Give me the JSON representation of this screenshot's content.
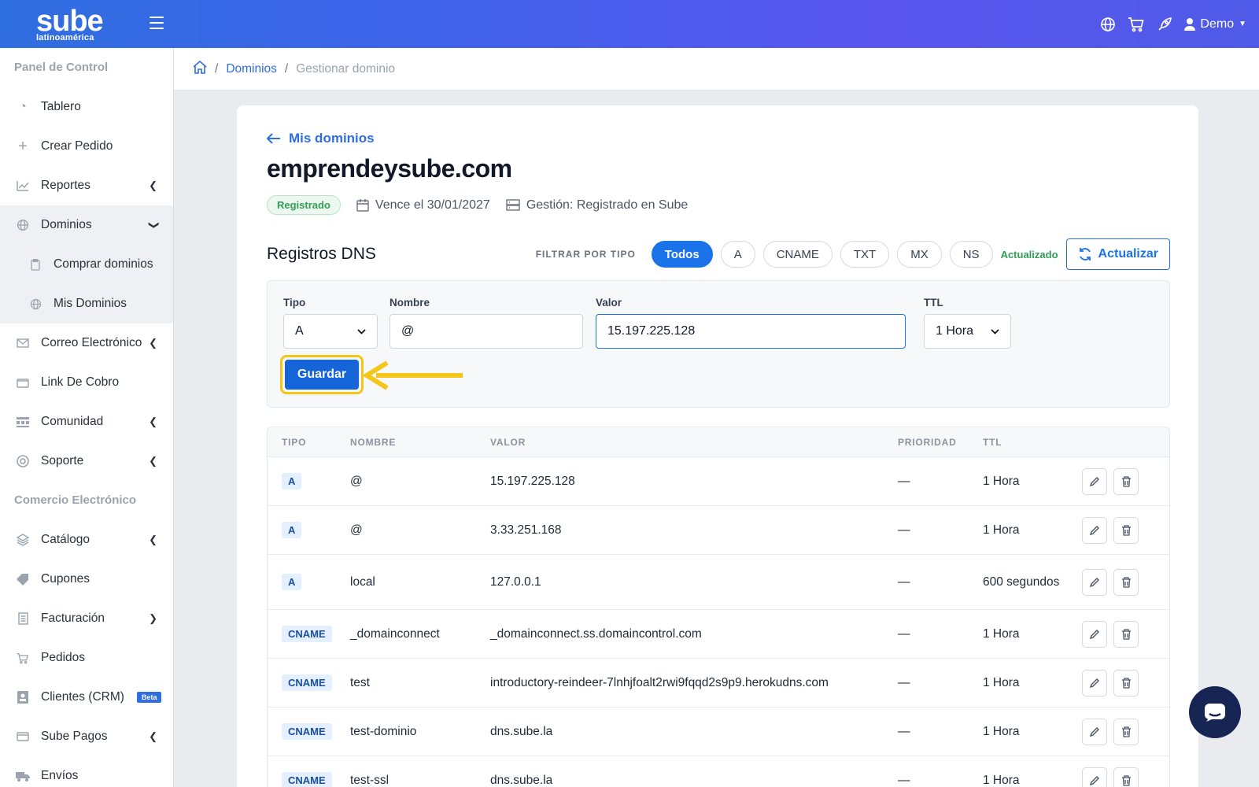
{
  "app": {
    "logo_main": "sube",
    "logo_sub": "latinoamérica",
    "user": "Demo"
  },
  "sidebar": {
    "section1": "Panel de Control",
    "section2": "Comercio Electrónico",
    "items": [
      {
        "label": "Tablero",
        "icon": "gauge-icon"
      },
      {
        "label": "Crear Pedido",
        "icon": "plus-icon"
      },
      {
        "label": "Reportes",
        "icon": "chart-line-icon"
      },
      {
        "label": "Dominios",
        "icon": "globe-icon"
      },
      {
        "label": "Comprar dominios",
        "icon": "clipboard-icon"
      },
      {
        "label": "Mis Dominios",
        "icon": "globe-icon"
      },
      {
        "label": "Correo Electrónico",
        "icon": "envelope-icon"
      },
      {
        "label": "Link De Cobro",
        "icon": "wallet-icon"
      },
      {
        "label": "Comunidad",
        "icon": "community-icon"
      },
      {
        "label": "Soporte",
        "icon": "lifebuoy-icon"
      },
      {
        "label": "Catálogo",
        "icon": "layers-icon"
      },
      {
        "label": "Cupones",
        "icon": "tag-icon"
      },
      {
        "label": "Facturación",
        "icon": "receipt-icon"
      },
      {
        "label": "Pedidos",
        "icon": "cart-icon"
      },
      {
        "label": "Clientes (CRM)",
        "icon": "contacts-icon",
        "badge": "Beta"
      },
      {
        "label": "Sube Pagos",
        "icon": "card-icon"
      },
      {
        "label": "Envíos",
        "icon": "truck-icon"
      }
    ]
  },
  "breadcrumb": {
    "link": "Dominios",
    "current": "Gestionar dominio"
  },
  "header": {
    "back": "Mis dominios",
    "domain": "emprendeysube.com",
    "status": "Registrado",
    "expires": "Vence el 30/01/2027",
    "management": "Gestión: Registrado en Sube"
  },
  "dns": {
    "title": "Registros DNS",
    "filter_label": "FILTRAR POR TIPO",
    "filters": [
      "Todos",
      "A",
      "CNAME",
      "TXT",
      "MX",
      "NS"
    ],
    "updated": "Actualizado",
    "refresh": "Actualizar"
  },
  "form": {
    "type_label": "Tipo",
    "type_value": "A",
    "name_label": "Nombre",
    "name_value": "@",
    "value_label": "Valor",
    "value_value": "15.197.225.128",
    "ttl_label": "TTL",
    "ttl_value": "1 Hora",
    "save": "Guardar"
  },
  "table": {
    "headers": [
      "TIPO",
      "NOMBRE",
      "VALOR",
      "PRIORIDAD",
      "TTL"
    ],
    "rows": [
      {
        "type": "A",
        "name": "@",
        "value": "15.197.225.128",
        "priority": "—",
        "ttl": "1 Hora"
      },
      {
        "type": "A",
        "name": "@",
        "value": "3.33.251.168",
        "priority": "—",
        "ttl": "1 Hora"
      },
      {
        "type": "A",
        "name": "local",
        "value": "127.0.0.1",
        "priority": "—",
        "ttl": "600 segundos"
      },
      {
        "type": "CNAME",
        "name": "_domainconnect",
        "value": "_domainconnect.ss.domaincontrol.com",
        "priority": "—",
        "ttl": "1 Hora"
      },
      {
        "type": "CNAME",
        "name": "test",
        "value": "introductory-reindeer-7lnhjfoalt2rwi9fqqd2s9p9.herokudns.com",
        "priority": "—",
        "ttl": "1 Hora"
      },
      {
        "type": "CNAME",
        "name": "test-dominio",
        "value": "dns.sube.la",
        "priority": "—",
        "ttl": "1 Hora"
      },
      {
        "type": "CNAME",
        "name": "test-ssl",
        "value": "dns.sube.la",
        "priority": "—",
        "ttl": "1 Hora"
      }
    ]
  },
  "colors": {
    "primary": "#1a73e8",
    "highlight": "#f5c518",
    "success": "#2f9e55"
  }
}
